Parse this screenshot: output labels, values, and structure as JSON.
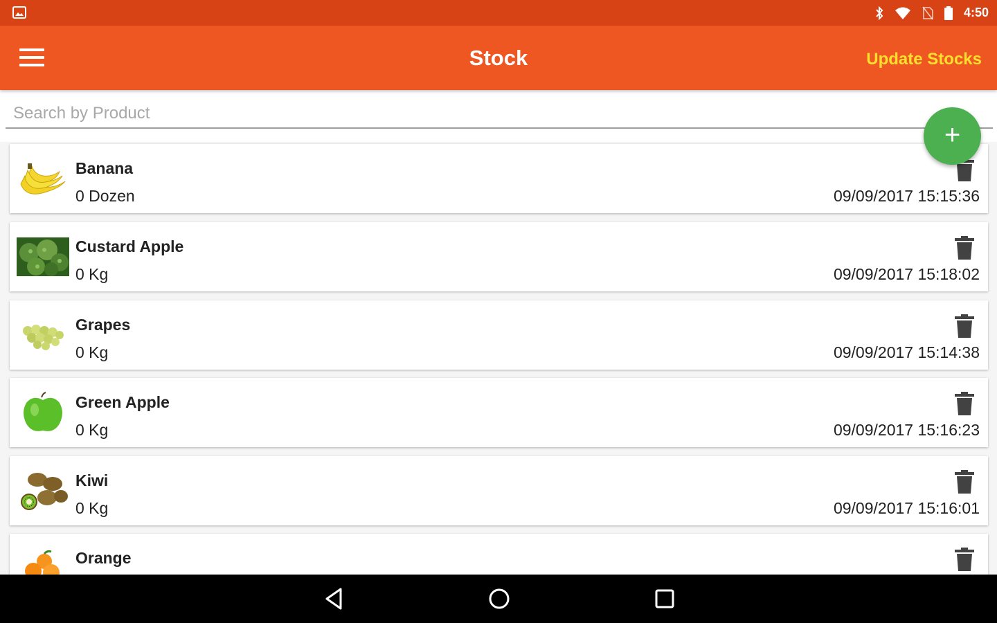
{
  "status_bar": {
    "time": "4:50"
  },
  "app_bar": {
    "title": "Stock",
    "action_label": "Update Stocks"
  },
  "search": {
    "placeholder": "Search by Product",
    "value": ""
  },
  "fab": {
    "label": "+"
  },
  "colors": {
    "status_bar": "#d84315",
    "app_bar": "#ee5722",
    "action_text": "#ffdf2e",
    "fab": "#4caf50",
    "nav_bar": "#000000"
  },
  "products": [
    {
      "name": "Banana",
      "quantity": "0 Dozen",
      "updated": "09/09/2017 15:15:36",
      "icon": "banana-image"
    },
    {
      "name": "Custard Apple",
      "quantity": "0 Kg",
      "updated": "09/09/2017 15:18:02",
      "icon": "custard-apple-image"
    },
    {
      "name": "Grapes",
      "quantity": "0 Kg",
      "updated": "09/09/2017 15:14:38",
      "icon": "grapes-image"
    },
    {
      "name": "Green Apple",
      "quantity": "0 Kg",
      "updated": "09/09/2017 15:16:23",
      "icon": "green-apple-image"
    },
    {
      "name": "Kiwi",
      "quantity": "0 Kg",
      "updated": "09/09/2017 15:16:01",
      "icon": "kiwi-image"
    },
    {
      "name": "Orange",
      "quantity": "",
      "updated": "",
      "icon": "orange-image"
    }
  ],
  "nav_bar": {
    "buttons": [
      "back",
      "home",
      "recents"
    ]
  }
}
